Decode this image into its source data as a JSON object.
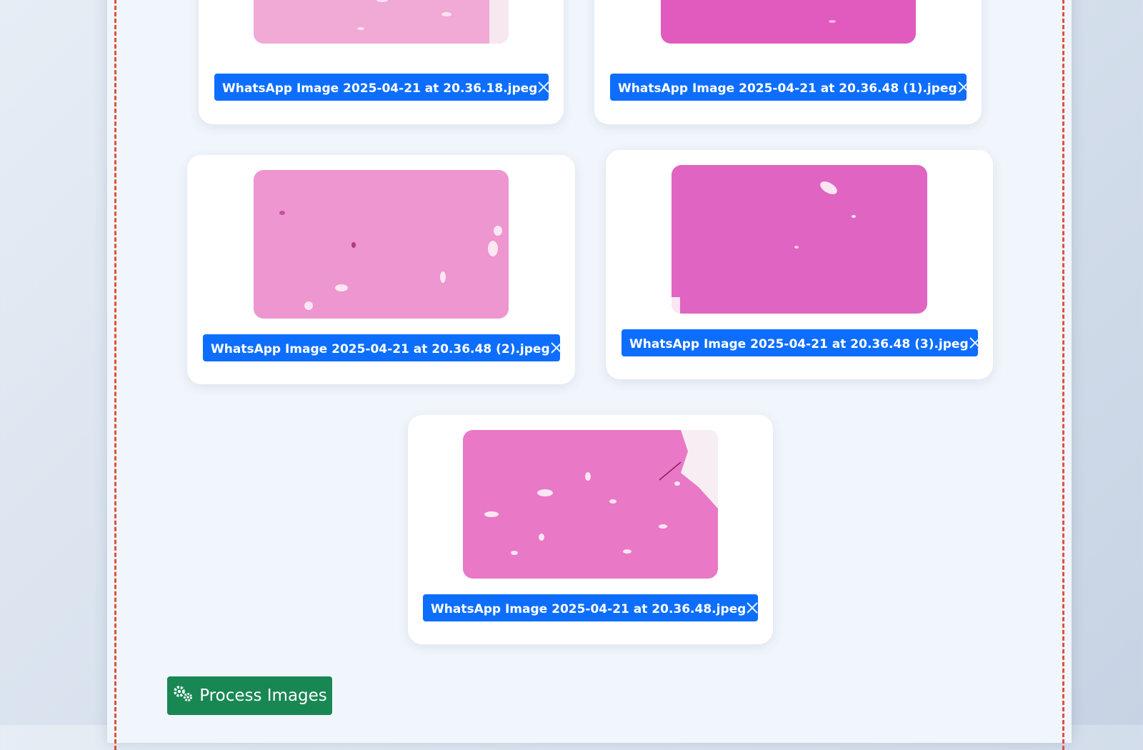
{
  "files": [
    {
      "name": "WhatsApp Image 2025-04-21 at 20.36.18.jpeg",
      "remove_icon": "close-icon"
    },
    {
      "name": "WhatsApp Image 2025-04-21 at 20.36.48 (1).jpeg",
      "remove_icon": "close-icon"
    },
    {
      "name": "WhatsApp Image 2025-04-21 at 20.36.48 (2).jpeg",
      "remove_icon": "close-icon"
    },
    {
      "name": "WhatsApp Image 2025-04-21 at 20.36.48 (3).jpeg",
      "remove_icon": "close-icon"
    },
    {
      "name": "WhatsApp Image 2025-04-21 at 20.36.48.jpeg",
      "remove_icon": "close-icon"
    }
  ],
  "actions": {
    "process_label": "Process Images",
    "process_icon": "gears-icon"
  },
  "colors": {
    "tag_background": "#0d6efd",
    "process_button": "#198754",
    "dropzone_border": "#e0503f",
    "panel_background": "#f1f6fc"
  }
}
